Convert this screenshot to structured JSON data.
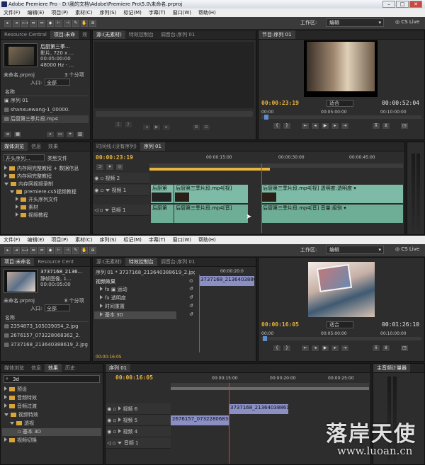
{
  "top": {
    "window_title": "Adobe Premiere Pro - D:\\我的文档\\Adobe\\Premiere Pro\\5.0\\未命名.prproj",
    "menu": [
      "文件(F)",
      "编辑(E)",
      "项目(P)",
      "素材(C)",
      "序列(S)",
      "标记(M)",
      "字幕(T)",
      "窗口(W)",
      "帮助(H)"
    ],
    "workspace_label": "工作区:",
    "workspace_value": "编辑",
    "cs_live": "CS Live",
    "project_tabs": [
      "Resource Central",
      "项目:未命",
      "效"
    ],
    "project_clip_name": "后厨第三季...",
    "project_clip_info": [
      "影片, 720 x ...",
      "00:05:00:00",
      "48000 Hz - ..."
    ],
    "project_file": "未命名.prproj",
    "project_count": "3 个分项",
    "in_label": "入口:",
    "in_value": "全部",
    "name_col": "名称",
    "project_items": [
      "序列 01",
      "shanxuewang-1_00000.",
      "后厨第三季片段.mp4"
    ],
    "source_tabs": [
      "源:(无素材)",
      "特效控制台",
      "调音台:序列 01"
    ],
    "program_tab": "节目:序列 01",
    "program_tc_in": "00:00:23:19",
    "program_fit": "适合",
    "program_tc_out": "00:00:52:04",
    "program_ruler": [
      "00:00",
      "00:05:00:00",
      "00:10:00:00"
    ],
    "media_tabs": [
      "媒体浏览",
      "信息",
      "效果"
    ],
    "media_btn1": "开头序列...",
    "media_btn2": "类型文件",
    "media_items": [
      "内存网完整教程 + 数据信息",
      "内存网完整教程",
      "内存网视频录制",
      "premiere.cs5视频教程",
      "开头序列文件",
      "素材",
      "视频教程"
    ],
    "timeline_tabs": [
      "时间线:(没有序列)",
      "序列 01"
    ],
    "timeline_tc": "00:00:23:19",
    "timeline_ruler": [
      "00:00:15:00",
      "00:00:30:00",
      "00:00:45:00"
    ],
    "track_v2": "视频 2",
    "track_v1": "视频 1",
    "track_a1": "音频 1",
    "clip_v1a": "后厨第",
    "clip_v1b": "后厨第三季片段.mp4[视]",
    "clip_v1c": "后厨第三季片段.mp4[视] 透明度:透明度 ▾",
    "clip_a1a": "后厨第",
    "clip_a1b": "后厨第三季片段.mp4[音]",
    "clip_a1c": "后厨第三季片段.mp4[音] 音量:级别 ▾"
  },
  "bottom": {
    "menu": [
      "文件(F)",
      "编辑(E)",
      "项目(P)",
      "素材(C)",
      "序列(S)",
      "标记(M)",
      "字幕(T)",
      "窗口(W)",
      "帮助(H)"
    ],
    "workspace_label": "工作区:",
    "workspace_value": "编辑",
    "cs_live": "CS Live",
    "project_tabs": [
      "项目:未命名",
      "Resource Cent"
    ],
    "project_clip_name": "3737168_2136...",
    "project_clip_info": [
      "静帧图像, 1...",
      "00:00:05:00"
    ],
    "project_file": "未命名.prproj",
    "project_count": "8 个分项",
    "in_label": "入口:",
    "in_value": "全部",
    "name_col": "名称",
    "project_items": [
      "2354873_105039054_2.jpg",
      "2676157_073228068362_2.",
      "3737168_213640388619_2.jpg"
    ],
    "source_tabs": [
      "源:(无素材)",
      "特效控制台",
      "调音台:序列 01"
    ],
    "fx_header": "序列 01 * 3737168_213640388619_2.jpg",
    "fx_section": "视频效果",
    "fx_items": [
      "运动",
      "透明度",
      "时间重置",
      "基本 3D"
    ],
    "fx_tc_top": "00:00:20:0",
    "fx_clip": "3737168_213640388619_2.j",
    "fx_tc": "00:00:16:05",
    "program_tc_in": "00:00:16:05",
    "program_fit": "适合",
    "program_tc_out": "00:01:26:10",
    "program_ruler": [
      "00:00",
      "00:05:00:00",
      "00:10:00:00"
    ],
    "effects_tabs": [
      "媒体浏览",
      "信息",
      "效果",
      "历史"
    ],
    "effects_search": "3d",
    "effects_tree": [
      "预设",
      "音频特效",
      "音频过渡",
      "视频特效",
      "透视",
      "基本 3D",
      "视频切换"
    ],
    "timeline_tab": "序列 01",
    "timeline_tc": "00:00:16:05",
    "timeline_ruler": [
      "00:00:15:00",
      "00:00:20:00",
      "00:00:25:00"
    ],
    "track_v6": "视频 6",
    "track_v5": "视频 5",
    "track_v4": "视频 4",
    "track_a1": "音频 1",
    "clip_v6": "3737168_213640388619_2.jpg",
    "clip_v5": "2676157_073228068362_2.jp",
    "master_meter": "主音频计量器"
  },
  "watermark": {
    "chinese": "落岸天使",
    "url": "www.luoan.cn"
  },
  "colors": {
    "timecode": "#e8b540",
    "video_clip": "#7dbba6",
    "pic_clip": "#8a8fc4",
    "playhead": "#ee3333",
    "folder": "#d9a53b"
  }
}
